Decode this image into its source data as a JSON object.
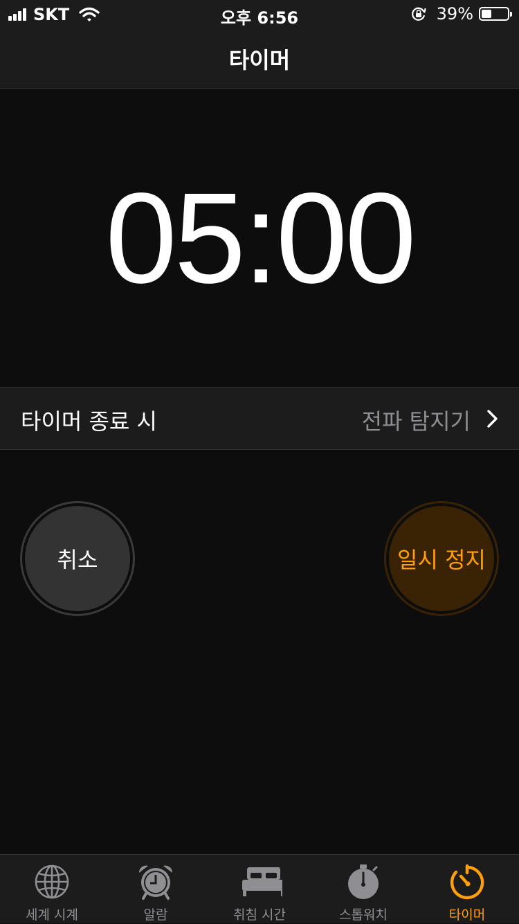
{
  "status_bar": {
    "carrier": "SKT",
    "time": "오후 6:56",
    "battery_percent": "39%",
    "battery_level": 0.39,
    "icons": [
      "cellular-signal-icon",
      "wifi-icon",
      "orientation-lock-icon",
      "battery-icon"
    ]
  },
  "nav": {
    "title": "타이머"
  },
  "timer": {
    "remaining": "05:00"
  },
  "end_setting": {
    "label": "타이머 종료 시",
    "value": "전파 탐지기"
  },
  "buttons": {
    "cancel": "취소",
    "pause": "일시 정지"
  },
  "tabs": [
    {
      "label": "세계 시계",
      "icon": "globe-icon",
      "active": false
    },
    {
      "label": "알람",
      "icon": "alarm-clock-icon",
      "active": false
    },
    {
      "label": "취침 시간",
      "icon": "bed-icon",
      "active": false
    },
    {
      "label": "스톱워치",
      "icon": "stopwatch-icon",
      "active": false
    },
    {
      "label": "타이머",
      "icon": "timer-icon",
      "active": true
    }
  ],
  "colors": {
    "accent": "#ff9f0a",
    "background": "#0d0d0d",
    "bar": "#1c1c1c",
    "inactive": "#8e8e93"
  }
}
